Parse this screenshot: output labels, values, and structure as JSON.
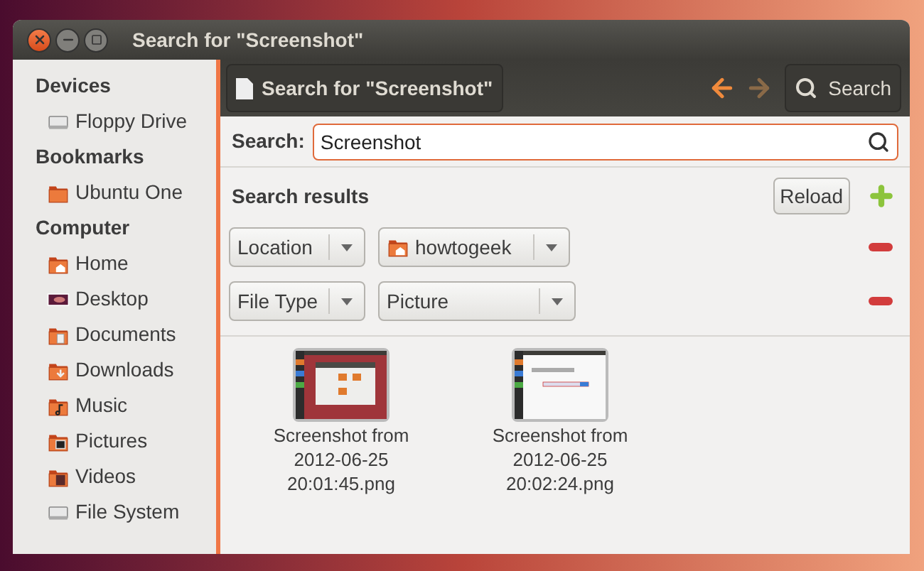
{
  "window": {
    "title": "Search for \"Screenshot\""
  },
  "sidebar": {
    "sections": [
      {
        "heading": "Devices",
        "items": [
          {
            "label": "Floppy Drive",
            "kind": "drive"
          }
        ]
      },
      {
        "heading": "Bookmarks",
        "items": [
          {
            "label": "Ubuntu One",
            "kind": "folder"
          }
        ]
      },
      {
        "heading": "Computer",
        "items": [
          {
            "label": "Home",
            "kind": "home"
          },
          {
            "label": "Desktop",
            "kind": "desktop"
          },
          {
            "label": "Documents",
            "kind": "documents"
          },
          {
            "label": "Downloads",
            "kind": "downloads"
          },
          {
            "label": "Music",
            "kind": "music"
          },
          {
            "label": "Pictures",
            "kind": "pictures"
          },
          {
            "label": "Videos",
            "kind": "videos"
          },
          {
            "label": "File System",
            "kind": "drive"
          }
        ]
      }
    ]
  },
  "toolbar": {
    "location_button": "Search for \"Screenshot\"",
    "back_enabled": true,
    "forward_enabled": false,
    "search_button": "Search"
  },
  "search": {
    "label": "Search:",
    "value": "Screenshot"
  },
  "results": {
    "heading": "Search results",
    "reload_button": "Reload",
    "criteria": [
      {
        "type": "Location",
        "value": "howtogeek",
        "kind": "folder"
      },
      {
        "type": "File Type",
        "value": "Picture",
        "kind": "plain"
      }
    ]
  },
  "files": [
    {
      "name": "Screenshot from 2012-06-25 20:01:45.png",
      "kind": "picture"
    },
    {
      "name": "Screenshot from 2012-06-25 20:02:24.png",
      "kind": "picture"
    }
  ]
}
